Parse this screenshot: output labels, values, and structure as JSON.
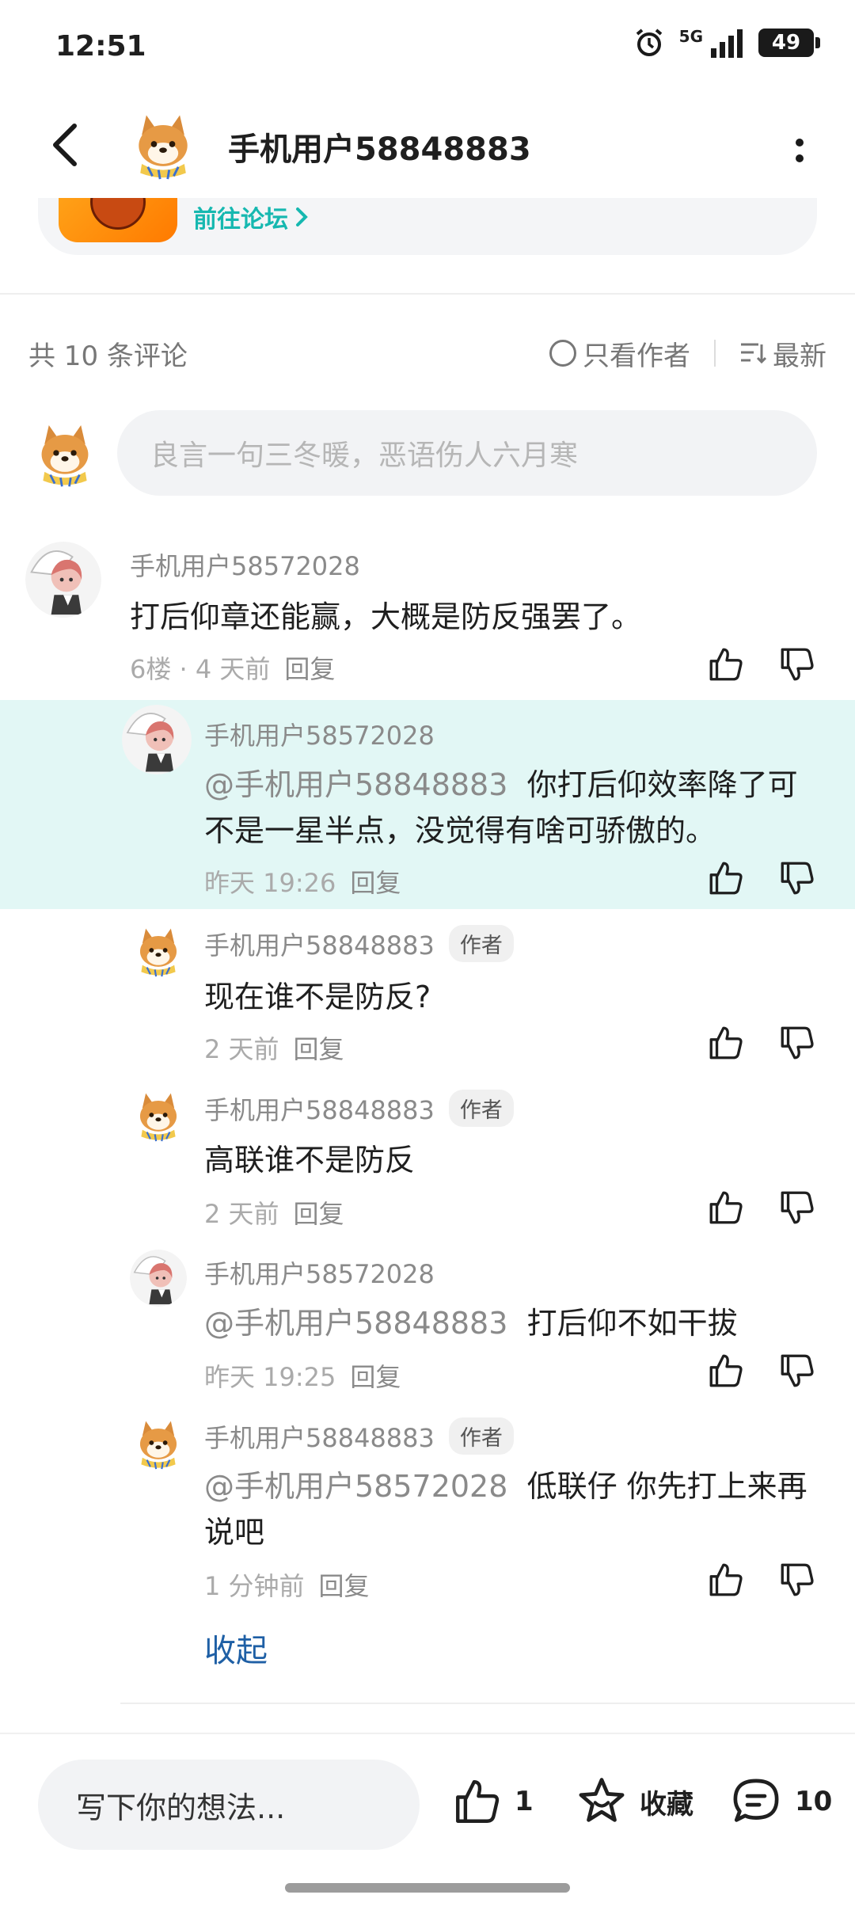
{
  "status_bar": {
    "time": "12:51",
    "network": "5G",
    "battery": "49"
  },
  "header": {
    "title": "手机用户58848883"
  },
  "forum_card": {
    "link_label": "前往论坛"
  },
  "comments_bar": {
    "count_label": "共 10 条评论",
    "author_only_label": "只看作者",
    "sort_label": "最新"
  },
  "comment_input": {
    "placeholder": "良言一句三冬暖，恶语伤人六月寒"
  },
  "comments": [
    {
      "user": "手机用户58572028",
      "text": "打后仰章还能赢，大概是防反强罢了。",
      "meta": "6楼 · 4 天前",
      "reply_label": "回复"
    },
    {
      "user": "手机用户58572028",
      "mention": "@手机用户58848883",
      "text": "你打后仰效率降了可不是一星半点，没觉得有啥可骄傲的。",
      "meta": "昨天 19:26",
      "reply_label": "回复"
    },
    {
      "user": "手机用户58848883",
      "author_tag": "作者",
      "text": "现在谁不是防反?",
      "meta": "2 天前",
      "reply_label": "回复"
    },
    {
      "user": "手机用户58848883",
      "author_tag": "作者",
      "text": "高联谁不是防反",
      "meta": "2 天前",
      "reply_label": "回复"
    },
    {
      "user": "手机用户58572028",
      "mention": "@手机用户58848883",
      "text": "打后仰不如干拔",
      "meta": "昨天 19:25",
      "reply_label": "回复"
    },
    {
      "user": "手机用户58848883",
      "author_tag": "作者",
      "mention": "@手机用户58572028",
      "text": "低联仔 你先打上来再说吧",
      "meta": "1 分钟前",
      "reply_label": "回复"
    }
  ],
  "collapse_label": "收起",
  "bottom_bar": {
    "input_placeholder": "写下你的想法...",
    "like_count": "1",
    "favorite_label": "收藏",
    "comment_count": "10"
  },
  "colors": {
    "accent": "#16b8b0",
    "highlight_bg": "#e2f7f5",
    "link": "#1e5fa5"
  }
}
